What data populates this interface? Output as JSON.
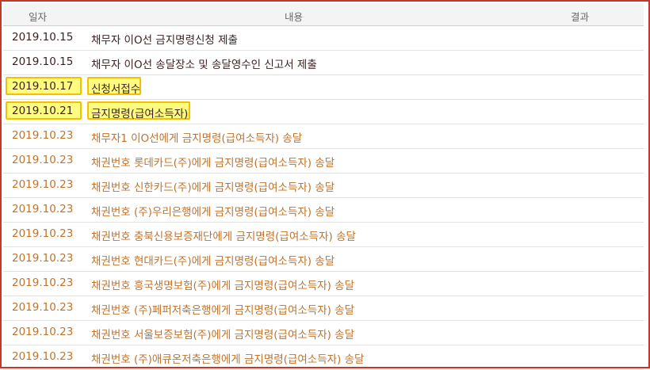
{
  "header": {
    "date": "일자",
    "content": "내용",
    "result": "결과"
  },
  "rows": [
    {
      "date": "2019.10.15",
      "content": "채무자 이O선 금지명령신청 제출"
    },
    {
      "date": "2019.10.15",
      "content": "채무자 이O선 송달장소 및 송달영수인 신고서 제출"
    },
    {
      "date": "2019.10.17",
      "content": "신청서접수"
    },
    {
      "date": "2019.10.21",
      "content": "금지명령(급여소득자)"
    },
    {
      "date": "2019.10.23",
      "content": "채무자1 이O선에게 금지명령(급여소득자) 송달"
    },
    {
      "date": "2019.10.23",
      "content": "채권번호 롯데카드(주)에게 금지명령(급여소득자) 송달"
    },
    {
      "date": "2019.10.23",
      "content": "채권번호 신한카드(주)에게 금지명령(급여소득자) 송달"
    },
    {
      "date": "2019.10.23",
      "content": "채권번호 (주)우리은행에게 금지명령(급여소득자) 송달"
    },
    {
      "date": "2019.10.23",
      "content": "채권번호 충북신용보증재단에게 금지명령(급여소득자) 송달"
    },
    {
      "date": "2019.10.23",
      "content": "채권번호 현대카드(주)에게 금지명령(급여소득자) 송달"
    },
    {
      "date": "2019.10.23",
      "content": "채권번호 흥국생명보험(주)에게 금지명령(급여소득자) 송달"
    },
    {
      "date": "2019.10.23",
      "content": "채권번호 (주)페퍼저축은행에게 금지명령(급여소득자) 송달"
    },
    {
      "date": "2019.10.23",
      "content": "채권번호 서울보증보험(주)에게 금지명령(급여소득자) 송달"
    },
    {
      "date": "2019.10.23",
      "content": "채권번호 (주)애큐온저축은행에게 금지명령(급여소득자) 송달"
    }
  ],
  "colors": {
    "frame": "#c0392b",
    "dark_text": "#3a1f1f",
    "orange_text": "#c0732a",
    "highlight": "#fffb80"
  }
}
